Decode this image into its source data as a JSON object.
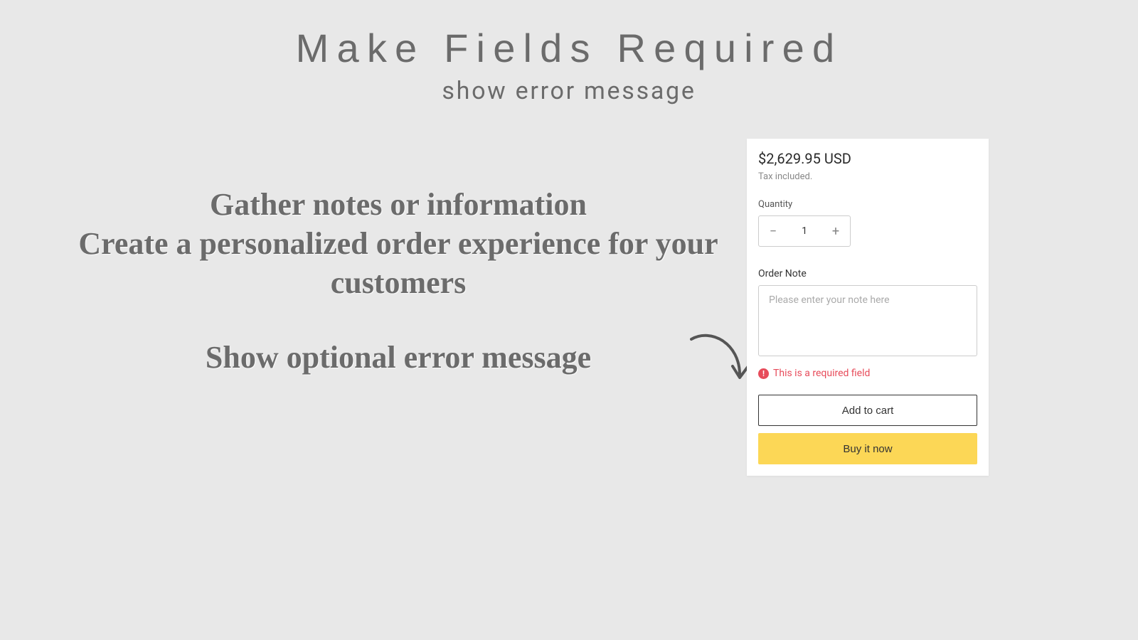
{
  "header": {
    "title": "Make Fields Required",
    "subtitle": "show error message"
  },
  "promo": {
    "line1": "Gather notes or information",
    "line2": "Create a personalized order experience for your customers",
    "line3": "Show optional error message"
  },
  "card": {
    "price": "$2,629.95 USD",
    "tax_note": "Tax included.",
    "quantity_label": "Quantity",
    "quantity_value": "1",
    "minus": "−",
    "plus": "+",
    "order_note_label": "Order Note",
    "order_note_placeholder": "Please enter your note here",
    "error_message": "This is a required field",
    "error_glyph": "!",
    "add_to_cart": "Add to cart",
    "buy_now": "Buy it now"
  },
  "colors": {
    "bg": "#e8e8e8",
    "text_muted": "#6b6b6b",
    "error": "#e74c5b",
    "buy_bg": "#fcd756"
  }
}
